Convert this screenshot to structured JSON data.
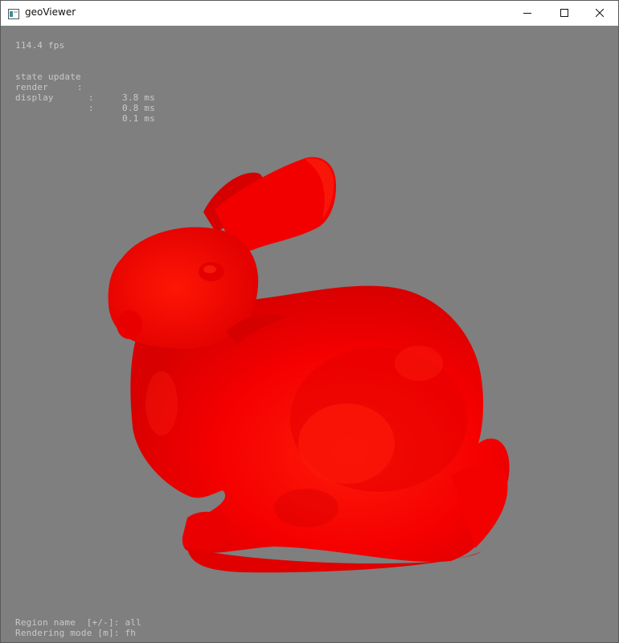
{
  "window": {
    "title": "geoViewer",
    "controls": {
      "minimize": "minimize",
      "maximize": "maximize",
      "close": "close"
    }
  },
  "overlay": {
    "fps": "114.4 fps",
    "stats": [
      {
        "label": "state update",
        "colon": ":",
        "value": "3.8 ms"
      },
      {
        "label": "render",
        "colon": ":",
        "value": "0.8 ms"
      },
      {
        "label": "display",
        "colon": ":",
        "value": "0.1 ms"
      }
    ],
    "region_line": "Region name  [+/-]: all",
    "mode_line": "Rendering mode [m]: fh"
  },
  "model": {
    "name_icon": "bunny-model",
    "color": "#ff0000",
    "background": "#7f7f7f"
  }
}
